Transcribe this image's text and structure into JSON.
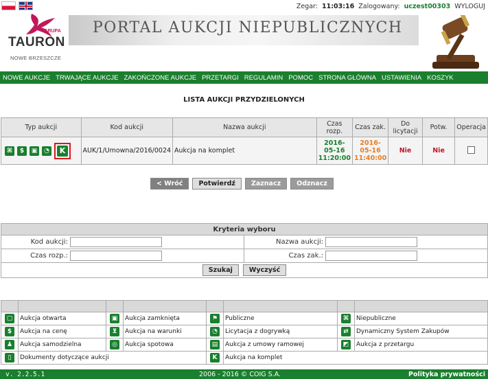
{
  "header": {
    "clock_label": "Zegar:",
    "clock_value": "11:03:16",
    "user_label": "Zalogowany:",
    "user_value": "uczest00303",
    "logout": "WYLOGUJ",
    "logo_grupa": "GRUPA",
    "logo_name": "TAURON",
    "logo_city": "NOWE BRZESZCZE",
    "portal_title": "PORTAL AUKCJI NIEPUBLICZNYCH"
  },
  "nav": [
    "NOWE AUKCJE",
    "TRWAJĄCE AUKCJE",
    "ZAKOŃCZONE AUKCJE",
    "PRZETARGI",
    "REGULAMIN",
    "POMOC",
    "STRONA GŁÓWNA",
    "USTAWIENIA",
    "KOSZYK"
  ],
  "page_title": "LISTA AUKCJI PRZYDZIELONYCH",
  "table": {
    "headers": {
      "type": "Typ aukcji",
      "code": "Kod aukcji",
      "name": "Nazwa aukcji",
      "start": "Czas rozp.",
      "end": "Czas zak.",
      "bidding": "Do licytacji",
      "confirm": "Potw.",
      "operation": "Operacja"
    },
    "rows": [
      {
        "code": "AUK/1/Umowna/2016/0024",
        "name": "Aukcja na komplet",
        "start": "2016-05-16 11:20:00",
        "end": "2016-05-16 11:40:00",
        "bidding": "Nie",
        "confirm": "Nie"
      }
    ]
  },
  "buttons": {
    "back": "< Wróć",
    "confirm": "Potwierdź",
    "select": "Zaznacz",
    "deselect": "Odznacz"
  },
  "criteria": {
    "title": "Kryteria wyboru",
    "code_label": "Kod aukcji:",
    "name_label": "Nazwa aukcji:",
    "start_label": "Czas rozp.:",
    "end_label": "Czas zak.:",
    "search": "Szukaj",
    "clear": "Wyczyść"
  },
  "legend": {
    "open": "Aukcja otwarta",
    "closed": "Aukcja zamknięta",
    "public": "Publiczne",
    "nonpublic": "Niepubliczne",
    "price": "Aukcja na cenę",
    "terms": "Aukcja na warunki",
    "extra": "Licytacja z dogrywką",
    "dsz": "Dynamiczny System Zakupów",
    "independent": "Aukcja samodzielna",
    "spot": "Aukcja spotowa",
    "framework": "Aukcja z umowy ramowej",
    "tender": "Aukcja z przetargu",
    "docs": "Dokumenty dotyczące aukcji",
    "set": "Aukcja na komplet"
  },
  "footer": {
    "version": "v. 2.2.5.1",
    "copyright": "2006 - 2016 © COIG S.A.",
    "privacy": "Polityka prywatności"
  },
  "colors": {
    "brand_green": "#1a7f2e",
    "date_start": "#1a7f2e",
    "date_end": "#e67e22",
    "no_red": "#c0162c",
    "logo_magenta": "#c2185b"
  }
}
